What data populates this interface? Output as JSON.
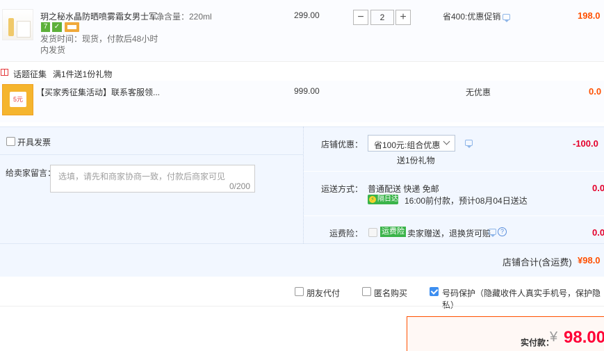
{
  "item1": {
    "title": "玥之秘水晶防晒喷雾霜女男士军...",
    "spec": "净含量：220ml",
    "ship_line1": "发货时间：现货，付款后48小时",
    "ship_line2": "内发货",
    "badge_7": "7",
    "price": "299.00",
    "qty": "2",
    "minus": "−",
    "plus": "+",
    "promo": "省400:优惠促销",
    "subtotal": "198.0"
  },
  "gift_row": {
    "label": "话题征集",
    "desc": "满1件送1份礼物"
  },
  "item2": {
    "title": "【买家秀征集活动】联系客服领...",
    "price": "999.00",
    "promo": "无优惠",
    "subtotal": "0.0",
    "thumb_text": "5元"
  },
  "invoice": {
    "label": "开具发票"
  },
  "message": {
    "label": "给卖家留言：",
    "placeholder": "选填，请先和商家协商一致，付款后商家可见",
    "counter": "0/200"
  },
  "shop_discount": {
    "label": "店铺优惠：",
    "select": "省100元:组合优惠",
    "gift": "送1份礼物",
    "amount": "-100.0"
  },
  "shipping": {
    "label": "运送方式：",
    "method": "普通配送 快递 免邮",
    "badge": "隔日达",
    "eta": "16:00前付款，预计08月04日送达",
    "amount": "0.0"
  },
  "insurance": {
    "label": "运费险：",
    "badge": "运费险",
    "desc": "卖家赠送，退换货可赔",
    "amount": "0.0"
  },
  "shop_total": {
    "label": "店铺合计(含运费)",
    "amount": "¥98.0"
  },
  "options": {
    "friend_pay": "朋友代付",
    "anonymous": "匿名购买",
    "privacy": "号码保护（隐藏收件人真实手机号，保护隐私）"
  },
  "pay": {
    "label": "实付款：",
    "currency": "¥",
    "amount": "98.00"
  },
  "colors": {
    "orange": "#ff5000",
    "red": "#e4002b",
    "panel_bg": "#f2f7ff",
    "checkbox_blue": "#3d8ef0"
  }
}
